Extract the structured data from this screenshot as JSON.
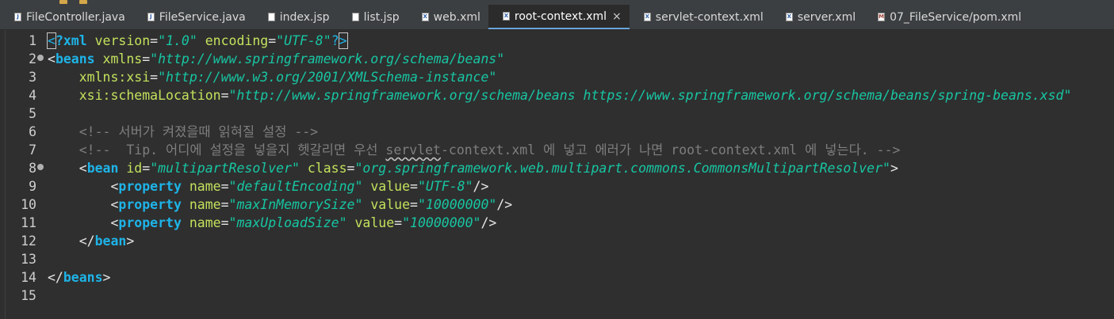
{
  "tabs": [
    {
      "label": "FileController.java",
      "icon": "java-file-icon",
      "icon_glyph": "J",
      "type": "java",
      "active": false
    },
    {
      "label": "FileService.java",
      "icon": "java-file-icon",
      "icon_glyph": "J",
      "type": "java",
      "active": false
    },
    {
      "label": "index.jsp",
      "icon": "jsp-file-icon",
      "icon_glyph": "",
      "type": "jsp",
      "active": false
    },
    {
      "label": "list.jsp",
      "icon": "jsp-file-icon",
      "icon_glyph": "",
      "type": "jsp",
      "active": false
    },
    {
      "label": "web.xml",
      "icon": "xml-file-icon",
      "icon_glyph": "X",
      "type": "xml",
      "active": false
    },
    {
      "label": "root-context.xml",
      "icon": "xml-file-icon",
      "icon_glyph": "X",
      "type": "xml",
      "active": true,
      "close": "×"
    },
    {
      "label": "servlet-context.xml",
      "icon": "xml-file-icon",
      "icon_glyph": "X",
      "type": "xml",
      "active": false
    },
    {
      "label": "server.xml",
      "icon": "xml-file-icon",
      "icon_glyph": "X",
      "type": "xml",
      "active": false
    },
    {
      "label": "07_FileService/pom.xml",
      "icon": "maven-pom-icon",
      "icon_glyph": "M",
      "type": "pom",
      "active": false
    }
  ],
  "editor": {
    "lines": [
      {
        "n": "1",
        "fold": false,
        "tokens": [
          {
            "t": "<",
            "c": "t-pi caret-box"
          },
          {
            "t": "?xml",
            "c": "t-tag"
          },
          {
            "t": " "
          },
          {
            "t": "version",
            "c": "t-attr"
          },
          {
            "t": "=",
            "c": "t-punc"
          },
          {
            "t": "\"1.0\"",
            "c": "t-val"
          },
          {
            "t": " "
          },
          {
            "t": "encoding",
            "c": "t-attr"
          },
          {
            "t": "=",
            "c": "t-punc"
          },
          {
            "t": "\"UTF-8\"",
            "c": "t-val"
          },
          {
            "t": "?",
            "c": "t-pi"
          },
          {
            "t": ">",
            "c": "t-pi caret-box"
          }
        ]
      },
      {
        "n": "2",
        "fold": true,
        "tokens": [
          {
            "t": "<",
            "c": "t-punc"
          },
          {
            "t": "beans",
            "c": "t-tag"
          },
          {
            "t": " "
          },
          {
            "t": "xmlns",
            "c": "t-attr"
          },
          {
            "t": "=",
            "c": "t-punc"
          },
          {
            "t": "\"http://www.springframework.org/schema/beans\"",
            "c": "t-val"
          }
        ]
      },
      {
        "n": "3",
        "fold": false,
        "tokens": [
          {
            "t": "    "
          },
          {
            "t": "xmlns:xsi",
            "c": "t-attr"
          },
          {
            "t": "=",
            "c": "t-punc"
          },
          {
            "t": "\"http://www.w3.org/2001/XMLSchema-instance\"",
            "c": "t-val"
          }
        ]
      },
      {
        "n": "4",
        "fold": false,
        "tokens": [
          {
            "t": "    "
          },
          {
            "t": "xsi:schemaLocation",
            "c": "t-attr"
          },
          {
            "t": "=",
            "c": "t-punc"
          },
          {
            "t": "\"http://www.springframework.org/schema/beans https://www.springframework.org/schema/beans/spring-beans.xsd\"",
            "c": "t-val"
          }
        ]
      },
      {
        "n": "5",
        "fold": false,
        "tokens": []
      },
      {
        "n": "6",
        "fold": false,
        "tokens": [
          {
            "t": "    "
          },
          {
            "t": "<!-- 서버가 켜졌을때 읽혀질 설정 -->",
            "c": "t-comment"
          }
        ]
      },
      {
        "n": "7",
        "fold": false,
        "tokens": [
          {
            "t": "    "
          },
          {
            "t": "<!--  Tip. 어디에 설정을 넣을지 헷갈리면 우선 ",
            "c": "t-comment"
          },
          {
            "t": "servlet",
            "c": "t-comment squiggle"
          },
          {
            "t": "-context.xml 에 넣고 에러가 나면 root-context.xml 에 넣는다. -->",
            "c": "t-comment"
          }
        ]
      },
      {
        "n": "8",
        "fold": true,
        "tokens": [
          {
            "t": "    "
          },
          {
            "t": "<",
            "c": "t-punc"
          },
          {
            "t": "bean",
            "c": "t-tag"
          },
          {
            "t": " "
          },
          {
            "t": "id",
            "c": "t-attr"
          },
          {
            "t": "=",
            "c": "t-punc"
          },
          {
            "t": "\"multipartResolver\"",
            "c": "t-val"
          },
          {
            "t": " "
          },
          {
            "t": "class",
            "c": "t-attr"
          },
          {
            "t": "=",
            "c": "t-punc"
          },
          {
            "t": "\"org.springframework.web.multipart.commons.CommonsMultipartResolver\"",
            "c": "t-val"
          },
          {
            "t": ">",
            "c": "t-punc"
          }
        ]
      },
      {
        "n": "9",
        "fold": false,
        "tokens": [
          {
            "t": "        "
          },
          {
            "t": "<",
            "c": "t-punc"
          },
          {
            "t": "property",
            "c": "t-tag"
          },
          {
            "t": " "
          },
          {
            "t": "name",
            "c": "t-attr"
          },
          {
            "t": "=",
            "c": "t-punc"
          },
          {
            "t": "\"defaultEncoding\"",
            "c": "t-val"
          },
          {
            "t": " "
          },
          {
            "t": "value",
            "c": "t-attr"
          },
          {
            "t": "=",
            "c": "t-punc"
          },
          {
            "t": "\"UTF-8\"",
            "c": "t-val"
          },
          {
            "t": "/>",
            "c": "t-punc"
          }
        ]
      },
      {
        "n": "10",
        "fold": false,
        "tokens": [
          {
            "t": "        "
          },
          {
            "t": "<",
            "c": "t-punc"
          },
          {
            "t": "property",
            "c": "t-tag"
          },
          {
            "t": " "
          },
          {
            "t": "name",
            "c": "t-attr"
          },
          {
            "t": "=",
            "c": "t-punc"
          },
          {
            "t": "\"maxInMemorySize\"",
            "c": "t-val"
          },
          {
            "t": " "
          },
          {
            "t": "value",
            "c": "t-attr"
          },
          {
            "t": "=",
            "c": "t-punc"
          },
          {
            "t": "\"10000000\"",
            "c": "t-val"
          },
          {
            "t": "/>",
            "c": "t-punc"
          }
        ]
      },
      {
        "n": "11",
        "fold": false,
        "tokens": [
          {
            "t": "        "
          },
          {
            "t": "<",
            "c": "t-punc"
          },
          {
            "t": "property",
            "c": "t-tag"
          },
          {
            "t": " "
          },
          {
            "t": "name",
            "c": "t-attr"
          },
          {
            "t": "=",
            "c": "t-punc"
          },
          {
            "t": "\"maxUploadSize\"",
            "c": "t-val"
          },
          {
            "t": " "
          },
          {
            "t": "value",
            "c": "t-attr"
          },
          {
            "t": "=",
            "c": "t-punc"
          },
          {
            "t": "\"10000000\"",
            "c": "t-val"
          },
          {
            "t": "/>",
            "c": "t-punc"
          }
        ]
      },
      {
        "n": "12",
        "fold": false,
        "tokens": [
          {
            "t": "    "
          },
          {
            "t": "</",
            "c": "t-punc"
          },
          {
            "t": "bean",
            "c": "t-tag"
          },
          {
            "t": ">",
            "c": "t-punc"
          }
        ]
      },
      {
        "n": "13",
        "fold": false,
        "tokens": []
      },
      {
        "n": "14",
        "fold": false,
        "tokens": [
          {
            "t": "</",
            "c": "t-punc"
          },
          {
            "t": "beans",
            "c": "t-tag"
          },
          {
            "t": ">",
            "c": "t-punc"
          }
        ]
      },
      {
        "n": "15",
        "fold": false,
        "tokens": []
      }
    ]
  },
  "colors": {
    "tag": "#1eb4e8",
    "attribute": "#c3e25c",
    "value": "#17c6a3",
    "comment": "#7e7e7e",
    "editor_bg": "#2f2f2f",
    "tabbar_bg": "#3c3f41"
  }
}
